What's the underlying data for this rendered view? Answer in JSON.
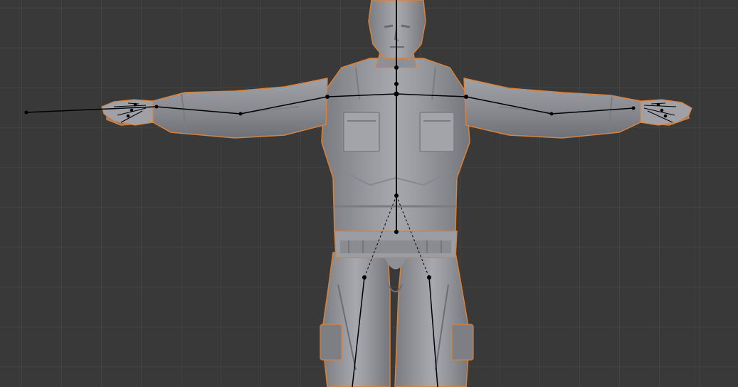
{
  "viewport": {
    "background_color": "#393939",
    "grid_color": "#434343",
    "selection_outline_color": "#d9823a",
    "mesh_color": "#8d8f96",
    "bone_color": "#000000"
  },
  "scene": {
    "mesh_object": "character-mesh",
    "armature_object": "armature-rig"
  }
}
